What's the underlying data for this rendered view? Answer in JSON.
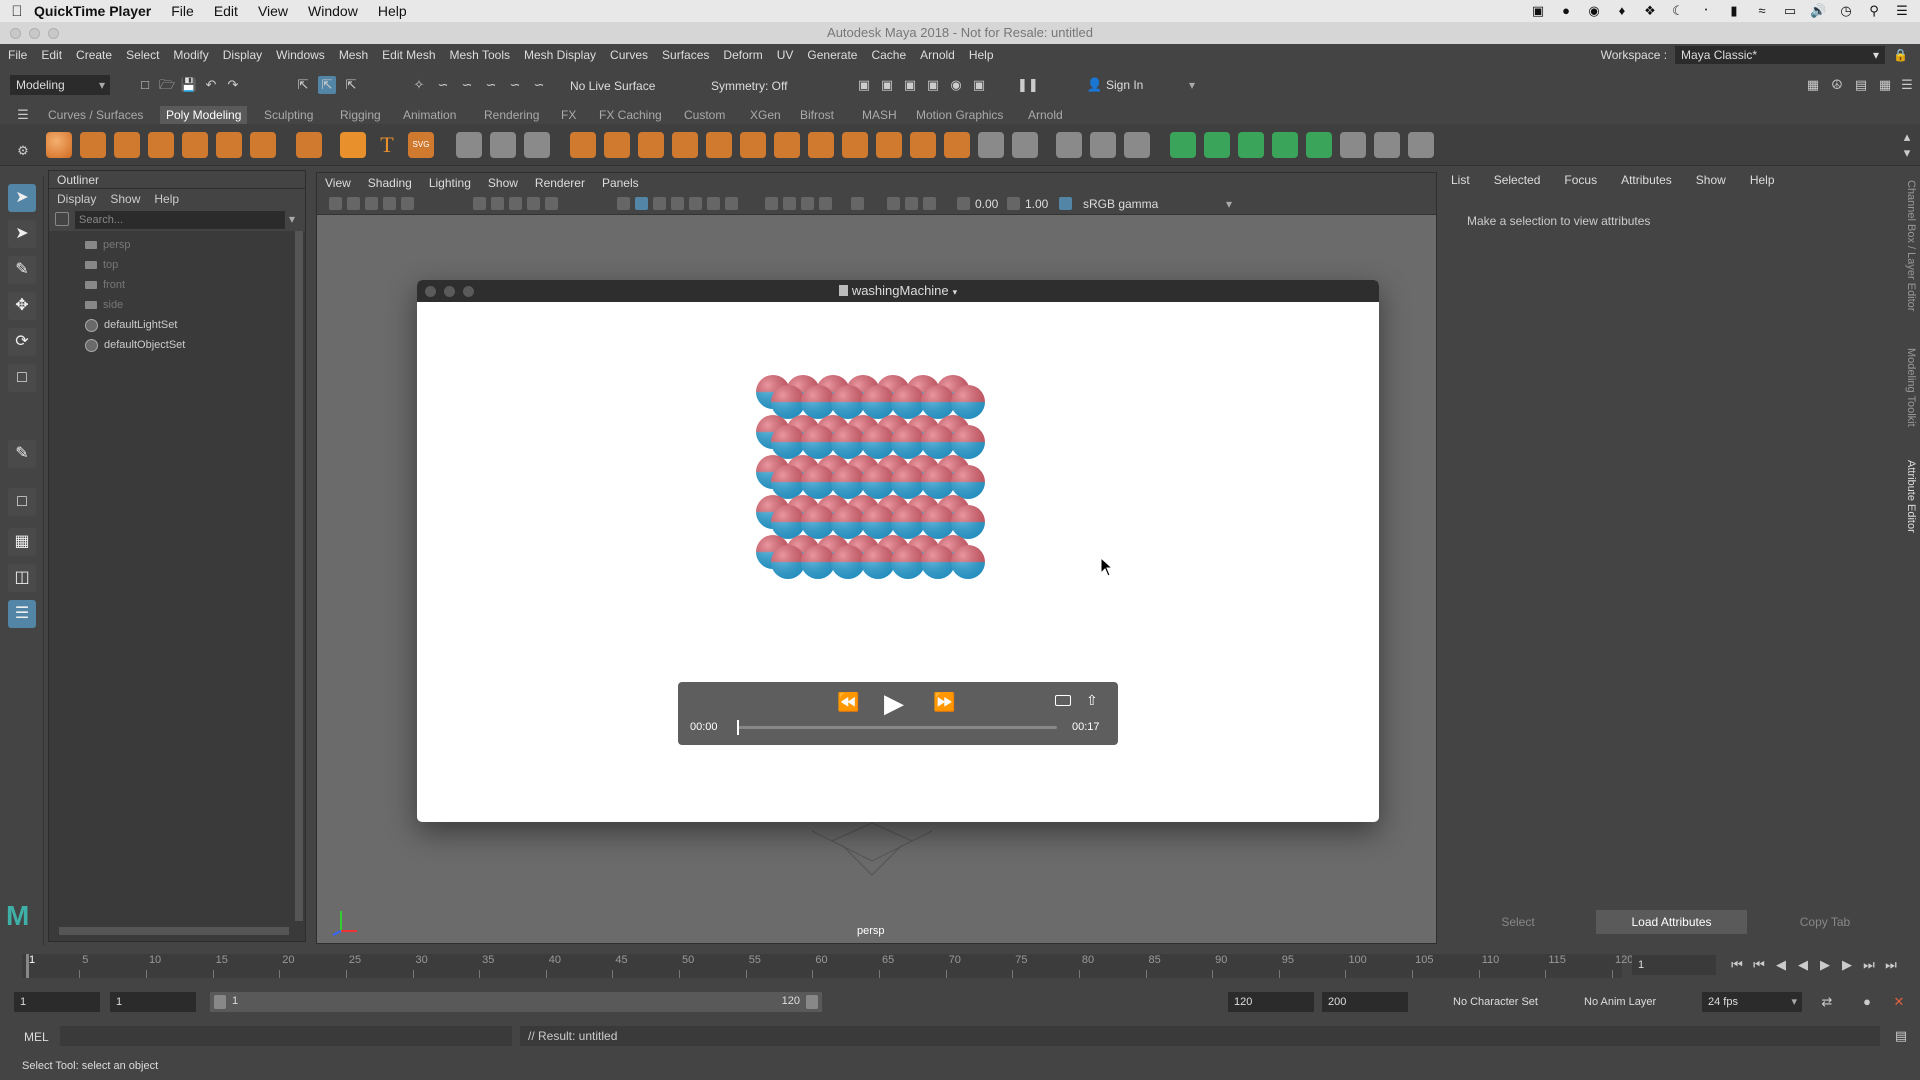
{
  "mac_menubar": {
    "app_name": "QuickTime Player",
    "items": [
      "File",
      "Edit",
      "View",
      "Window",
      "Help"
    ]
  },
  "maya_window": {
    "title": "Autodesk Maya 2018 - Not for Resale: untitled"
  },
  "maya_menu": {
    "items": [
      "File",
      "Edit",
      "Create",
      "Select",
      "Modify",
      "Display",
      "Windows",
      "Mesh",
      "Edit Mesh",
      "Mesh Tools",
      "Mesh Display",
      "Curves",
      "Surfaces",
      "Deform",
      "UV",
      "Generate",
      "Cache",
      "Arnold",
      "Help"
    ],
    "workspace_label": "Workspace :",
    "workspace_value": "Maya Classic*"
  },
  "status_line": {
    "mode": "Modeling",
    "live_surface": "No Live Surface",
    "symmetry": "Symmetry: Off",
    "sign_in": "Sign In"
  },
  "shelf_tabs": [
    "Curves / Surfaces",
    "Poly Modeling",
    "Sculpting",
    "Rigging",
    "Animation",
    "Rendering",
    "FX",
    "FX Caching",
    "Custom",
    "XGen",
    "Bifrost",
    "MASH",
    "Motion Graphics",
    "Arnold"
  ],
  "shelf_active_tab": "Poly Modeling",
  "outliner": {
    "title": "Outliner",
    "menu": [
      "Display",
      "Show",
      "Help"
    ],
    "search_placeholder": "Search...",
    "items": [
      "persp",
      "top",
      "front",
      "side",
      "defaultLightSet",
      "defaultObjectSet"
    ]
  },
  "viewport": {
    "menu": [
      "View",
      "Shading",
      "Lighting",
      "Show",
      "Renderer",
      "Panels"
    ],
    "exposure": "0.00",
    "gamma": "1.00",
    "color_space": "sRGB gamma",
    "camera_label": "persp"
  },
  "quicktime": {
    "title": "washingMachine",
    "current_time": "00:00",
    "duration": "00:17",
    "progress_fraction": 0.0
  },
  "attribute_editor": {
    "menu": [
      "List",
      "Selected",
      "Focus",
      "Attributes",
      "Show",
      "Help"
    ],
    "message": "Make a selection to view attributes",
    "buttons": [
      "Select",
      "Load Attributes",
      "Copy Tab"
    ]
  },
  "side_tabs": [
    "Channel Box / Layer Editor",
    "Modeling Toolkit",
    "Attribute Editor"
  ],
  "time_slider": {
    "ticks": [
      "1",
      "5",
      "10",
      "15",
      "20",
      "25",
      "30",
      "35",
      "40",
      "45",
      "50",
      "55",
      "60",
      "65",
      "70",
      "75",
      "80",
      "85",
      "90",
      "95",
      "100",
      "105",
      "110",
      "115",
      "120"
    ],
    "current_frame": "1"
  },
  "range_slider": {
    "start": "1",
    "playback_start": "1",
    "range_start_label": "1",
    "range_end_label": "120",
    "playback_end": "120",
    "end": "200",
    "character_set": "No Character Set",
    "anim_layer": "No Anim Layer",
    "fps": "24 fps"
  },
  "command_line": {
    "lang": "MEL",
    "result": "// Result: untitled"
  },
  "help_line": "Select Tool: select an object",
  "colors": {
    "sphere_red": "#e0606e",
    "sphere_blue": "#2aa8e0",
    "accent_blue": "#5285a6",
    "maya_logo": "#3fb0a8"
  }
}
